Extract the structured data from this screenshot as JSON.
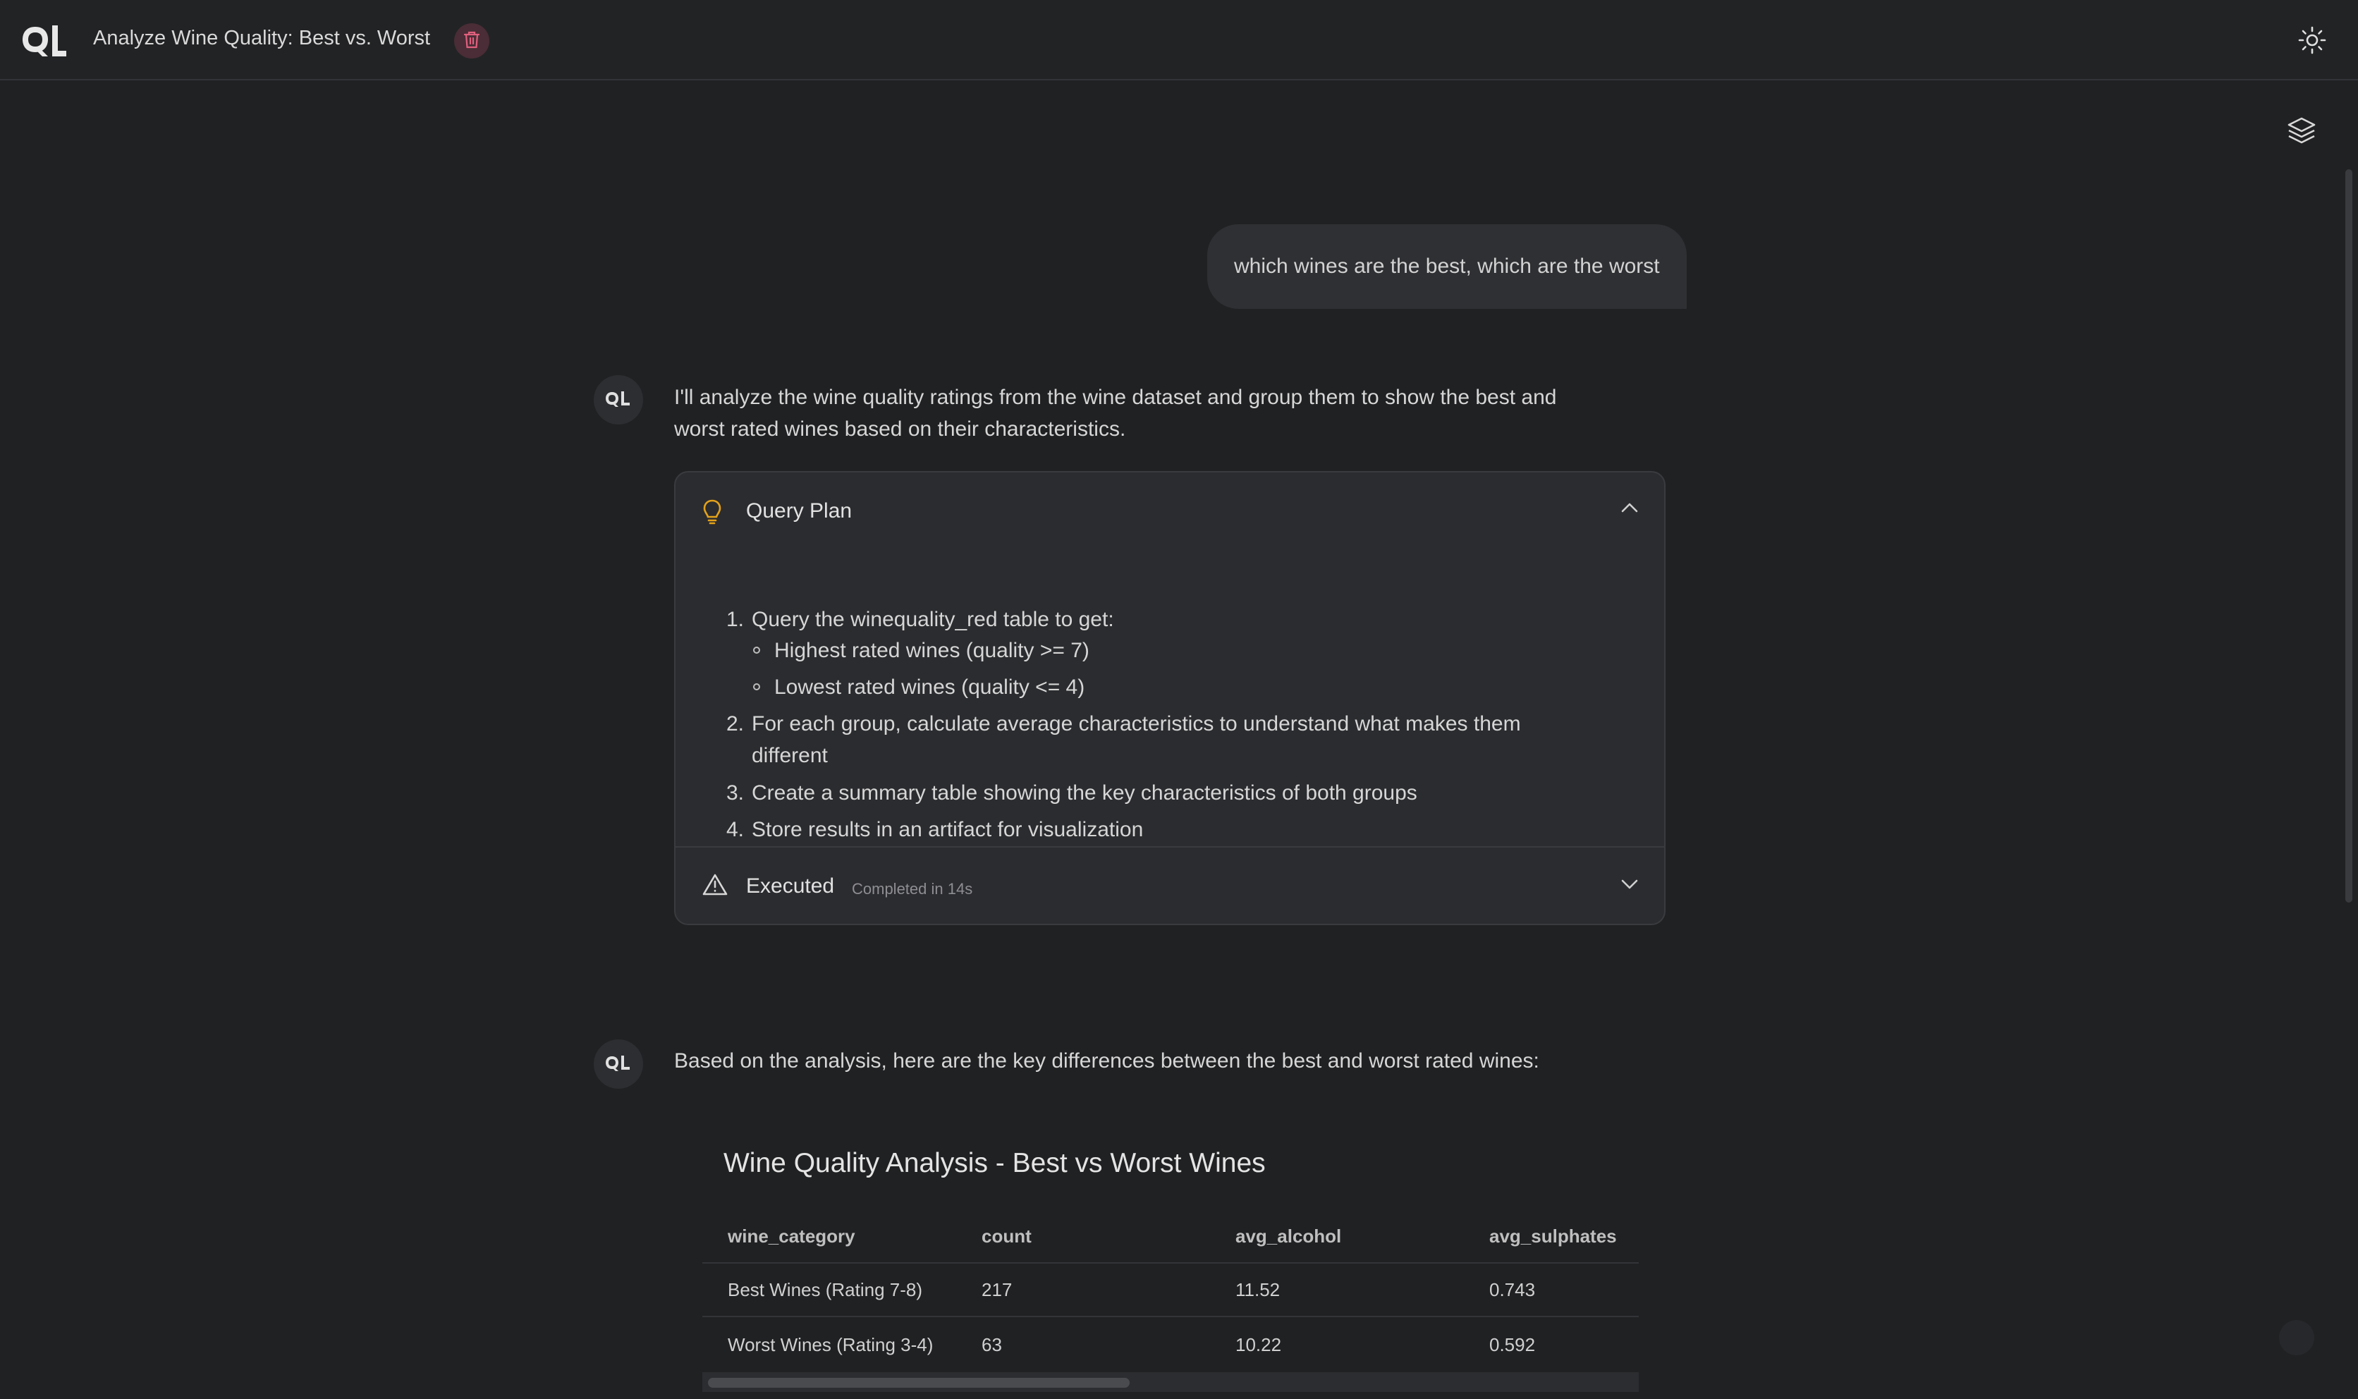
{
  "header": {
    "title": "Analyze Wine Quality: Best vs. Worst",
    "icons": {
      "logo": "ql-logo",
      "delete": "trash-icon",
      "theme": "sun-icon",
      "artifacts": "layers-icon"
    }
  },
  "colors": {
    "background": "#202123",
    "bubble": "#2f3033",
    "card": "#2b2c2f",
    "delete_bg": "#4a2d36",
    "delete_fg": "#e0607e",
    "bulb": "#e3a21a"
  },
  "conversation": {
    "user_message": "which wines are the best, which are the worst",
    "assistant_message_1": {
      "intro_line_1": "I'll analyze the wine quality ratings from the wine dataset and group them to show the best and",
      "intro_line_2": "worst rated wines based on their characteristics."
    },
    "query_plan": {
      "label": "Query Plan",
      "steps": [
        {
          "num": "1.",
          "text": "Query the winequality_red table to get:"
        },
        {
          "num": "2.",
          "text_line_1": "For each group, calculate average characteristics to understand what makes them",
          "text_line_2": "different"
        },
        {
          "num": "3.",
          "text": "Create a summary table showing the key characteristics of both groups"
        },
        {
          "num": "4.",
          "text": "Store results in an artifact for visualization"
        }
      ],
      "substeps": [
        "Highest rated wines (quality >= 7)",
        "Lowest rated wines (quality <= 4)"
      ],
      "execution": {
        "label": "Executed",
        "meta": "Completed in 14s"
      }
    },
    "assistant_message_2": {
      "text": "Based on the analysis, here are the key differences between the best and worst rated wines:"
    },
    "artifact": {
      "title": "Wine Quality Analysis - Best vs Worst Wines",
      "columns": [
        "wine_category",
        "count",
        "avg_alcohol",
        "avg_sulphates"
      ],
      "rows": [
        [
          "Best Wines (Rating 7-8)",
          "217",
          "11.52",
          "0.743"
        ],
        [
          "Worst Wines (Rating 3-4)",
          "63",
          "10.22",
          "0.592"
        ]
      ]
    }
  }
}
